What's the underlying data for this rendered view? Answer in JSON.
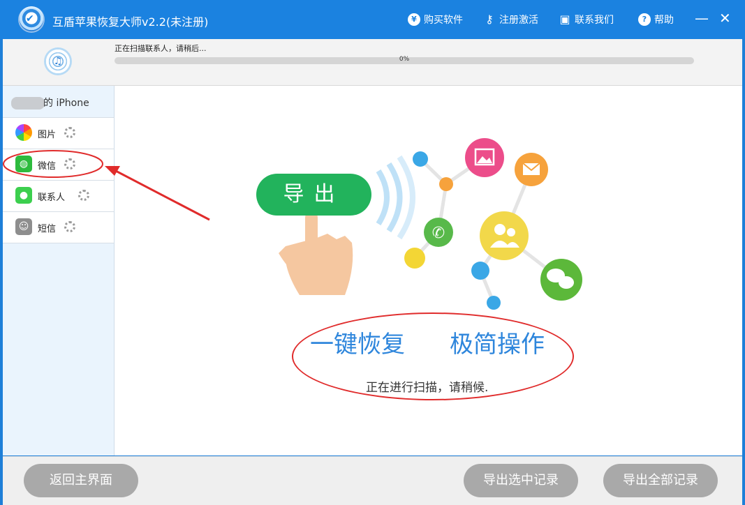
{
  "window": {
    "title": "互盾苹果恢复大师v2.2(未注册)",
    "nav": [
      {
        "label": "购买软件",
        "icon": "yen-icon"
      },
      {
        "label": "注册激活",
        "icon": "key-icon"
      },
      {
        "label": "联系我们",
        "icon": "chat-icon"
      },
      {
        "label": "帮助",
        "icon": "help-icon"
      }
    ],
    "minimize": "—",
    "close": "✕"
  },
  "scan": {
    "status": "正在扫描联系人，请稍后...",
    "progress_text": "0%",
    "progress": 0
  },
  "sidebar": {
    "device_label": "的 iPhone",
    "items": [
      {
        "label": "图片",
        "icon": "photos-icon"
      },
      {
        "label": "微信",
        "icon": "wechat-icon"
      },
      {
        "label": "联系人",
        "icon": "messages-icon"
      },
      {
        "label": "短信",
        "icon": "contacts-book-icon"
      }
    ]
  },
  "main": {
    "export_label": "导出",
    "slogan_left": "一键恢复",
    "slogan_right": "极简操作",
    "scan_hint": "正在进行扫描，请稍候."
  },
  "footer": {
    "back_label": "返回主界面",
    "export_selected_label": "导出选中记录",
    "export_all_label": "导出全部记录"
  },
  "colors": {
    "title_bar": "#1b82e0",
    "accent_green": "#22b35c",
    "slogan_blue": "#2e86dc",
    "annotation_red": "#e02b2b"
  }
}
